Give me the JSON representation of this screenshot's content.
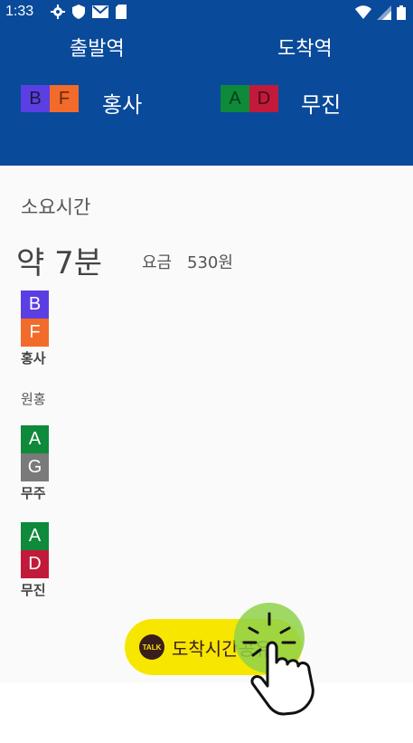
{
  "status_bar": {
    "time": "1:33",
    "icons_left": [
      "gear-icon",
      "shield-icon",
      "mail-icon",
      "sd-card-icon"
    ],
    "icons_right": [
      "wifi-icon",
      "signal-icon",
      "battery-icon"
    ]
  },
  "route": {
    "depart_title": "출발역",
    "arrive_title": "도착역",
    "depart": {
      "lines": [
        {
          "code": "B",
          "color": "#5b3fe3",
          "text_color": "#1a1a3a"
        },
        {
          "code": "F",
          "color": "#f26b2a",
          "text_color": "#6b2a10"
        }
      ],
      "station": "홍사"
    },
    "arrive": {
      "lines": [
        {
          "code": "A",
          "color": "#0e8a3a",
          "text_color": "#064018"
        },
        {
          "code": "D",
          "color": "#c21a3b",
          "text_color": "#4a0a18"
        }
      ],
      "station": "무진"
    }
  },
  "summary": {
    "time_label": "소요시간",
    "duration": "약 7분",
    "fare_label": "요금",
    "fare_value": "530원"
  },
  "stops": [
    {
      "lines": [
        {
          "code": "B",
          "color": "#5b3fe3"
        },
        {
          "code": "F",
          "color": "#f26b2a"
        }
      ],
      "name": "홍사"
    },
    {
      "name": "원홍",
      "passing": true
    },
    {
      "lines": [
        {
          "code": "A",
          "color": "#0e8a3a"
        },
        {
          "code": "G",
          "color": "#7a7a7a"
        }
      ],
      "name": "무주"
    },
    {
      "lines": [
        {
          "code": "A",
          "color": "#0e8a3a"
        },
        {
          "code": "D",
          "color": "#c21a3b"
        }
      ],
      "name": "무진"
    }
  ],
  "kakao": {
    "icon_text": "TALK",
    "label": "도착시간공유",
    "color": "#f7e600"
  }
}
